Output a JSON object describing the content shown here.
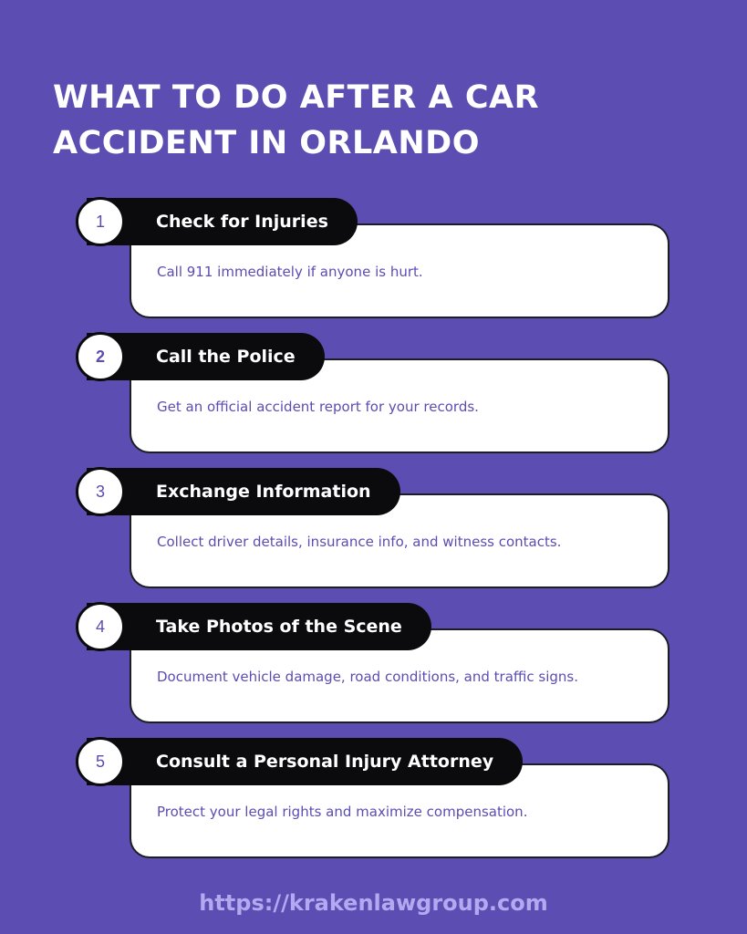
{
  "title": "WHAT TO DO AFTER A CAR ACCIDENT IN ORLANDO",
  "colors": {
    "background": "#5b4db2",
    "pill": "#0b0b0d",
    "card": "#ffffff",
    "body_text": "#5b4db2",
    "url_text": "#b3a9f0"
  },
  "steps": [
    {
      "number": "1",
      "heading": "Check for Injuries",
      "text": "Call 911 immediately if anyone is hurt."
    },
    {
      "number": "2",
      "heading": "Call the Police",
      "text": "Get an official accident report for your records."
    },
    {
      "number": "3",
      "heading": "Exchange Information",
      "text": "Collect driver details, insurance info, and witness contacts."
    },
    {
      "number": "4",
      "heading": "Take Photos of the Scene",
      "text": "Document vehicle damage, road conditions, and traffic signs."
    },
    {
      "number": "5",
      "heading": "Consult a Personal Injury Attorney",
      "text": "Protect your legal rights and maximize compensation."
    }
  ],
  "footer": {
    "url": "https://krakenlawgroup.com"
  }
}
